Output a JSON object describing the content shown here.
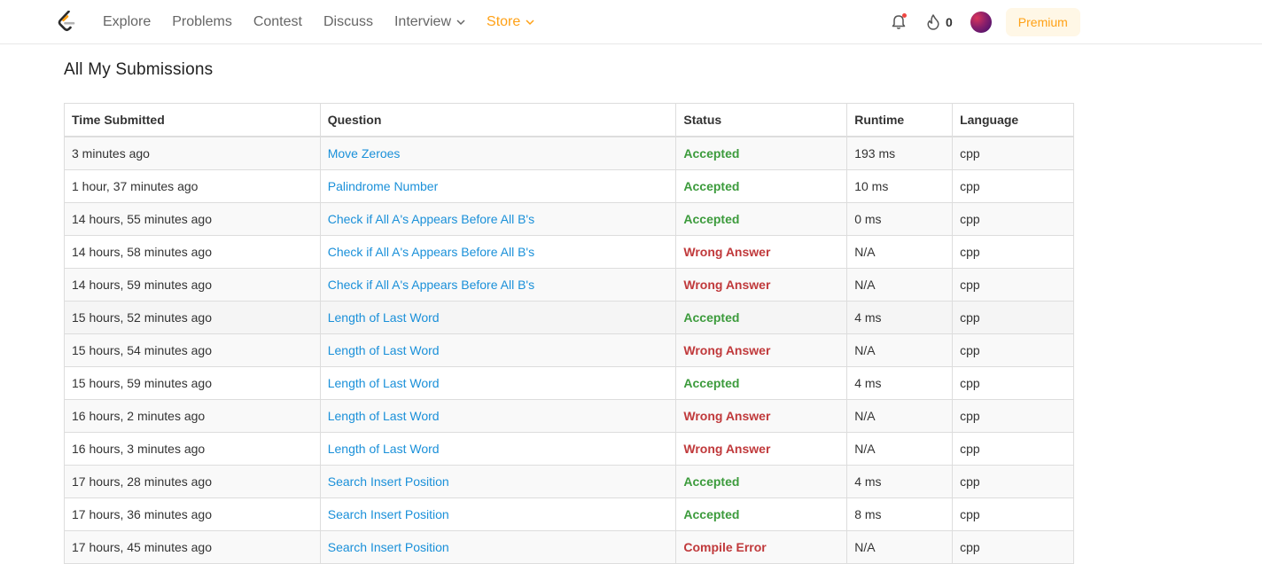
{
  "nav": {
    "links": [
      "Explore",
      "Problems",
      "Contest",
      "Discuss",
      "Interview",
      "Store"
    ],
    "streak": "0",
    "premium_label": "Premium",
    "icons": [
      "leetcode-logo-icon",
      "bell-icon",
      "fire-icon",
      "avatar"
    ],
    "colors": {
      "store": "#ffa116",
      "premium_bg": "#fff7e6",
      "notification_dot": "#ef4743"
    }
  },
  "page": {
    "title": "All My Submissions"
  },
  "table": {
    "headers": [
      "Time Submitted",
      "Question",
      "Status",
      "Runtime",
      "Language"
    ],
    "rows": [
      {
        "time": "3 minutes ago",
        "question": "Move Zeroes",
        "status": "Accepted",
        "runtime": "193 ms",
        "language": "cpp"
      },
      {
        "time": "1 hour, 37 minutes ago",
        "question": "Palindrome Number",
        "status": "Accepted",
        "runtime": "10 ms",
        "language": "cpp"
      },
      {
        "time": "14 hours, 55 minutes ago",
        "question": "Check if All A's Appears Before All B's",
        "status": "Accepted",
        "runtime": "0 ms",
        "language": "cpp"
      },
      {
        "time": "14 hours, 58 minutes ago",
        "question": "Check if All A's Appears Before All B's",
        "status": "Wrong Answer",
        "runtime": "N/A",
        "language": "cpp"
      },
      {
        "time": "14 hours, 59 minutes ago",
        "question": "Check if All A's Appears Before All B's",
        "status": "Wrong Answer",
        "runtime": "N/A",
        "language": "cpp"
      },
      {
        "time": "15 hours, 52 minutes ago",
        "question": "Length of Last Word",
        "status": "Accepted",
        "runtime": "4 ms",
        "language": "cpp"
      },
      {
        "time": "15 hours, 54 minutes ago",
        "question": "Length of Last Word",
        "status": "Wrong Answer",
        "runtime": "N/A",
        "language": "cpp"
      },
      {
        "time": "15 hours, 59 minutes ago",
        "question": "Length of Last Word",
        "status": "Accepted",
        "runtime": "4 ms",
        "language": "cpp"
      },
      {
        "time": "16 hours, 2 minutes ago",
        "question": "Length of Last Word",
        "status": "Wrong Answer",
        "runtime": "N/A",
        "language": "cpp"
      },
      {
        "time": "16 hours, 3 minutes ago",
        "question": "Length of Last Word",
        "status": "Wrong Answer",
        "runtime": "N/A",
        "language": "cpp"
      },
      {
        "time": "17 hours, 28 minutes ago",
        "question": "Search Insert Position",
        "status": "Accepted",
        "runtime": "4 ms",
        "language": "cpp"
      },
      {
        "time": "17 hours, 36 minutes ago",
        "question": "Search Insert Position",
        "status": "Accepted",
        "runtime": "8 ms",
        "language": "cpp"
      },
      {
        "time": "17 hours, 45 minutes ago",
        "question": "Search Insert Position",
        "status": "Compile Error",
        "runtime": "N/A",
        "language": "cpp"
      }
    ],
    "status_colors": {
      "Accepted": "#3c9b3c",
      "Wrong Answer": "#c0393b",
      "Compile Error": "#c0393b"
    },
    "link_color": "#1a90d9"
  }
}
